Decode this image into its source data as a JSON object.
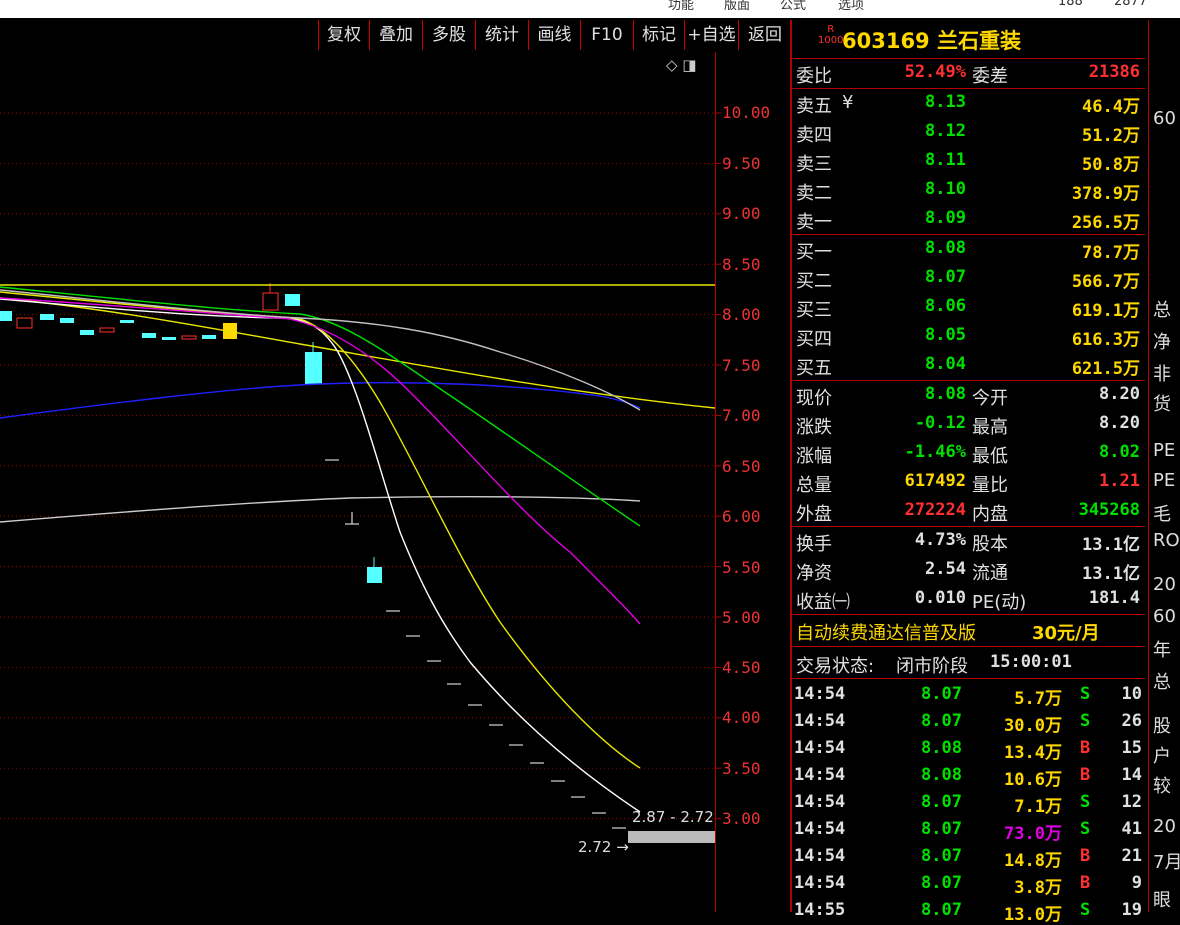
{
  "top_strip": {
    "items": [
      "功能",
      "版面",
      "公式",
      "选项",
      "188",
      "2877"
    ]
  },
  "toolbar": {
    "buttons": [
      "复权",
      "叠加",
      "多股",
      "统计",
      "画线",
      "F10",
      "标记",
      "+自选",
      "返回"
    ]
  },
  "chart": {
    "price_axis": [
      "10.00",
      "9.50",
      "9.00",
      "8.50",
      "8.00",
      "7.50",
      "7.00",
      "6.50",
      "6.00",
      "5.50",
      "5.00",
      "4.50",
      "4.00",
      "3.50",
      "3.00"
    ],
    "annot_range": "2.87 - 2.72",
    "annot_low": "2.72"
  },
  "stock": {
    "badge_top": "R",
    "badge_bottom": "1000",
    "code_name": "603169 兰石重装"
  },
  "weibi": {
    "label": "委比",
    "value": "52.49%",
    "label2": "委差",
    "value2": "21386"
  },
  "sells": [
    {
      "label": "卖五",
      "flag": "¥",
      "price": "8.13",
      "vol": "46.4万"
    },
    {
      "label": "卖四",
      "price": "8.12",
      "vol": "51.2万"
    },
    {
      "label": "卖三",
      "price": "8.11",
      "vol": "50.8万"
    },
    {
      "label": "卖二",
      "price": "8.10",
      "vol": "378.9万"
    },
    {
      "label": "卖一",
      "price": "8.09",
      "vol": "256.5万"
    }
  ],
  "buys": [
    {
      "label": "买一",
      "price": "8.08",
      "vol": "78.7万"
    },
    {
      "label": "买二",
      "price": "8.07",
      "vol": "566.7万"
    },
    {
      "label": "买三",
      "price": "8.06",
      "vol": "619.1万"
    },
    {
      "label": "买四",
      "price": "8.05",
      "vol": "616.3万"
    },
    {
      "label": "买五",
      "price": "8.04",
      "vol": "621.5万"
    }
  ],
  "quote": [
    {
      "l1": "现价",
      "v1": "8.08",
      "c1": "g",
      "l2": "今开",
      "v2": "8.20",
      "c2": "w"
    },
    {
      "l1": "涨跌",
      "v1": "-0.12",
      "c1": "g",
      "l2": "最高",
      "v2": "8.20",
      "c2": "w"
    },
    {
      "l1": "涨幅",
      "v1": "-1.46%",
      "c1": "g",
      "l2": "最低",
      "v2": "8.02",
      "c2": "g"
    },
    {
      "l1": "总量",
      "v1": "617492",
      "c1": "y",
      "l2": "量比",
      "v2": "1.21",
      "c2": "r"
    },
    {
      "l1": "外盘",
      "v1": "272224",
      "c1": "r",
      "l2": "内盘",
      "v2": "345268",
      "c2": "g"
    }
  ],
  "fund": [
    {
      "l1": "换手",
      "v1": "4.73%",
      "l2": "股本",
      "v2": "13.1亿"
    },
    {
      "l1": "净资",
      "v1": "2.54",
      "l2": "流通",
      "v2": "13.1亿"
    },
    {
      "l1": "收益㈠",
      "v1": "0.010",
      "l2": "PE(动)",
      "v2": "181.4"
    }
  ],
  "promo": {
    "text": "自动续费通达信普及版",
    "price": "30元/月"
  },
  "status": {
    "label": "交易状态:",
    "value": "闭市阶段",
    "time": "15:00:01"
  },
  "trades": [
    {
      "time": "14:54",
      "price": "8.07",
      "pc": "g",
      "vol": "5.7万",
      "vc": "y",
      "side": "S",
      "n": "10"
    },
    {
      "time": "14:54",
      "price": "8.07",
      "pc": "g",
      "vol": "30.0万",
      "vc": "y",
      "side": "S",
      "n": "26"
    },
    {
      "time": "14:54",
      "price": "8.08",
      "pc": "g",
      "vol": "13.4万",
      "vc": "y",
      "side": "B",
      "n": "15"
    },
    {
      "time": "14:54",
      "price": "8.08",
      "pc": "g",
      "vol": "10.6万",
      "vc": "y",
      "side": "B",
      "n": "14"
    },
    {
      "time": "14:54",
      "price": "8.07",
      "pc": "g",
      "vol": "7.1万",
      "vc": "y",
      "side": "S",
      "n": "12"
    },
    {
      "time": "14:54",
      "price": "8.07",
      "pc": "g",
      "vol": "73.0万",
      "vc": "m",
      "side": "S",
      "n": "41"
    },
    {
      "time": "14:54",
      "price": "8.07",
      "pc": "g",
      "vol": "14.8万",
      "vc": "y",
      "side": "B",
      "n": "21"
    },
    {
      "time": "14:54",
      "price": "8.07",
      "pc": "g",
      "vol": "3.8万",
      "vc": "y",
      "side": "B",
      "n": "9"
    },
    {
      "time": "14:55",
      "price": "8.07",
      "pc": "g",
      "vol": "13.0万",
      "vc": "y",
      "side": "S",
      "n": "19"
    }
  ],
  "right_edge": [
    "60",
    "总",
    "净",
    "非",
    "货",
    "PE",
    "PE",
    "毛",
    "RO",
    "20",
    "60",
    "年",
    "总",
    "股",
    "户",
    "较",
    "20",
    "7月",
    "眼"
  ],
  "colors": {
    "up": "#ff3030",
    "down": "#00e000",
    "grid": "#b00000",
    "accent": "#ffd800"
  }
}
